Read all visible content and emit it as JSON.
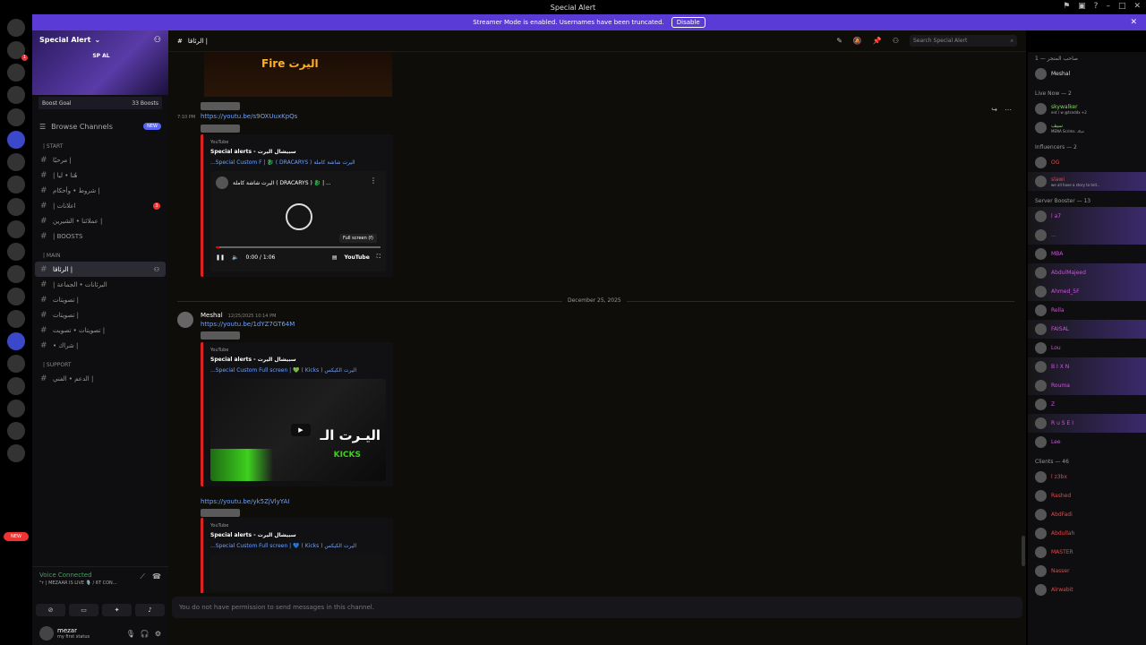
{
  "window": {
    "title": "Special Alert"
  },
  "banner": {
    "text": "Streamer Mode is enabled. Usernames have been truncated.",
    "disable": "Disable"
  },
  "server": {
    "name": "Special Alert",
    "logo_text": "SP AL",
    "boost_goal": "Boost Goal",
    "boosts": "33 Boosts",
    "browse": "Browse Channels",
    "new": "NEW",
    "categories": {
      "start": "| START",
      "main": "| MAIN",
      "support": "| SUPPORT"
    },
    "channels_start": [
      "مرحبًا |",
      "| هُنا • ليا",
      "شروط • وأحكام |",
      "| اعلانات",
      "عملائنا • الشيرين |",
      "| BOOSTS"
    ],
    "channels_main": [
      "الرئاقا |",
      "| البرئانات • الجماعة",
      "تصويتات |",
      "تصويتات |",
      "تصويتات • تصويت |",
      "• شراك |"
    ],
    "channels_support": [
      "الدعم • الفني |"
    ]
  },
  "servers_new": "NEW",
  "voice": {
    "status": "Voice Connected",
    "channel": "\"ᴛ | MEZAAR IS LIVE 🎙️ / 6T CON..."
  },
  "user": {
    "name": "mezar",
    "status": "my first status"
  },
  "chat": {
    "channel": "الرئاقا |",
    "search_placeholder": "Search Special Alert",
    "ts1": "7:10 PM",
    "link1": "https://youtu.be/s9OXUuxKpQs",
    "embed1": {
      "src": "YouTube",
      "author": "Special alerts - سبيشال اليرت",
      "title": "...Special Custom F | 🐉 ( DRACARYS ) اليرت شاشة كاملة",
      "video_title": "اليرت شاشة كاملة ( DRACARYS ) 🐉 | ...",
      "tooltip": "Full screen (f)",
      "time": "0:00 / 1:06",
      "yt": "YouTube"
    },
    "date": "December 25, 2025",
    "author": "Meshal",
    "ts2": "12/25/2025 10:14 PM",
    "link2": "https://youtu.be/1dYZ7GT64M",
    "embed2": {
      "src": "YouTube",
      "author": "Special alerts - سبيشال اليرت",
      "title": "...Special Custom Full screen | 💚 ( Kicks ) اليرت الكيكس",
      "overlay": "اليـرت الـ",
      "kicks": "KICKS"
    },
    "link3": "https://youtu.be/yk5ZjVlyYAI",
    "embed3": {
      "src": "YouTube",
      "author": "Special alerts - سبيشال اليرت",
      "title": "...Special Custom Full screen | 💙 ( Kicks ) اليرت الكيكس"
    },
    "no_perm": "You do not have permission to send messages in this channel.",
    "banner_text": "Fire اليرت"
  },
  "members": {
    "owner_cat": "صاحب المتجر — 1",
    "owner": "Meshal",
    "live_cat": "Live Now — 2",
    "live": [
      {
        "name": "skywalker",
        "sub": "ent / w @tsnddx +2"
      },
      {
        "name": "سيف",
        "sub": "MENA Scrims. حياك"
      }
    ],
    "inf_cat": "Influencers — 2",
    "inf": [
      {
        "name": "OG",
        "sub": ""
      },
      {
        "name": "slawi",
        "sub": "we all have a story to tell..."
      }
    ],
    "boost_cat": "Server Booster — 13",
    "boosters": [
      "l a7",
      "...",
      "MBA",
      "AbdulMajeed",
      "Ahmed_5F",
      "Rella",
      "FAISAL",
      "Lou",
      "B I X N",
      "Rouma",
      "Z",
      "R u S E I",
      "Lee"
    ],
    "clients_cat": "Clients — 46",
    "clients": [
      "l z3bx",
      "Rashed",
      "AbdFadi",
      "Abdullah",
      "MASTER",
      "Nasser",
      "Alrwabit"
    ]
  }
}
